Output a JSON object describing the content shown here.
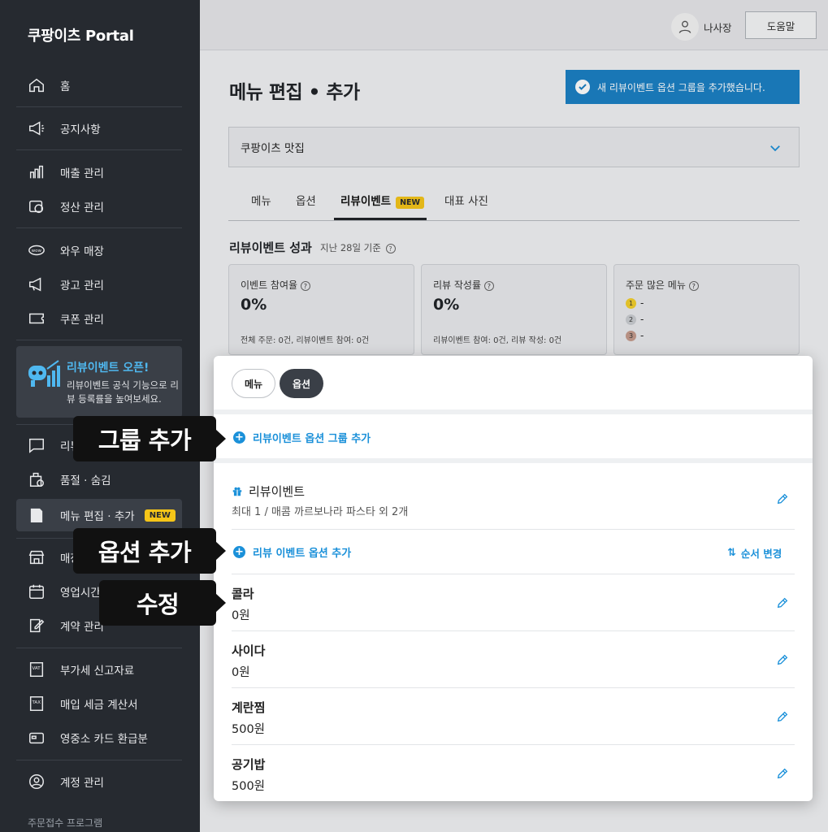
{
  "app": {
    "brand": "쿠팡이츠 Portal"
  },
  "sidebar": {
    "items": [
      {
        "label": "홈",
        "icon": "home-icon"
      },
      {
        "label": "공지사항",
        "icon": "megaphone-icon"
      },
      {
        "label": "매출 관리",
        "icon": "bar-chart-icon"
      },
      {
        "label": "정산 관리",
        "icon": "settlement-icon"
      },
      {
        "label": "와우 매장",
        "icon": "wow-icon"
      },
      {
        "label": "광고 관리",
        "icon": "ad-icon"
      },
      {
        "label": "쿠폰 관리",
        "icon": "coupon-icon"
      },
      {
        "label": "리뷰",
        "icon": "review-icon"
      },
      {
        "label": "품절 · 숨김",
        "icon": "soldout-icon"
      },
      {
        "label": "메뉴 편집 · 추가",
        "icon": "menu-book-icon",
        "badge": "NEW"
      },
      {
        "label": "매장",
        "icon": "store-icon"
      },
      {
        "label": "영업시간",
        "icon": "calendar-icon"
      },
      {
        "label": "계약 관리",
        "icon": "contract-icon"
      },
      {
        "label": "부가세 신고자료",
        "icon": "vat-icon"
      },
      {
        "label": "매입 세금 계산서",
        "icon": "tax-icon"
      },
      {
        "label": "영중소 카드 환급분",
        "icon": "card-icon"
      },
      {
        "label": "계정 관리",
        "icon": "account-icon"
      }
    ],
    "promo": {
      "title": "리뷰이벤트 오픈!",
      "desc": "리뷰이벤트 공식 기능으로 리뷰 등록률을 높여보세요."
    },
    "footer": "주문접수 프로그램"
  },
  "topbar": {
    "user_name": "나사장",
    "help_label": "도움말"
  },
  "page": {
    "title": "메뉴 편집 • 추가",
    "toast": "새 리뷰이벤트 옵션 그룹을 추가했습니다.",
    "store": "쿠팡이츠 맛집",
    "tabs": [
      {
        "label": "메뉴"
      },
      {
        "label": "옵션"
      },
      {
        "label": "리뷰이벤트",
        "badge": "NEW"
      },
      {
        "label": "대표 사진"
      }
    ],
    "perf_title": "리뷰이벤트 성과",
    "perf_sub": "지난 28일 기준",
    "stats": [
      {
        "label": "이벤트 참여율",
        "value": "0%",
        "foot": "전체 주문: 0건, 리뷰이벤트 참여: 0건"
      },
      {
        "label": "리뷰 작성률",
        "value": "0%",
        "foot": "리뷰이벤트 참여: 0건, 리뷰 작성: 0건"
      },
      {
        "label": "주문 많은 메뉴",
        "ranks": [
          {
            "n": "1",
            "v": "-"
          },
          {
            "n": "2",
            "v": "-"
          },
          {
            "n": "3",
            "v": "-"
          }
        ]
      }
    ]
  },
  "panel": {
    "pill_menu": "메뉴",
    "pill_option": "옵션",
    "add_group": "리뷰이벤트 옵션 그룹 추가",
    "group_name": "리뷰이벤트",
    "group_desc": "최대 1 / 매콤 까르보나라 파스타 외 2개",
    "add_option": "리뷰 이벤트 옵션 추가",
    "sort_label": "순서 변경",
    "options": [
      {
        "name": "콜라",
        "price": "0원"
      },
      {
        "name": "사이다",
        "price": "0원"
      },
      {
        "name": "계란찜",
        "price": "500원"
      },
      {
        "name": "공기밥",
        "price": "500원"
      }
    ]
  },
  "callouts": {
    "group_add": "그룹 추가",
    "option_add": "옵션 추가",
    "edit": "수정"
  },
  "colors": {
    "accent": "#1a90d9",
    "sidebar": "#262a30",
    "badge": "#f5c518",
    "toast": "#1a7fc4"
  }
}
